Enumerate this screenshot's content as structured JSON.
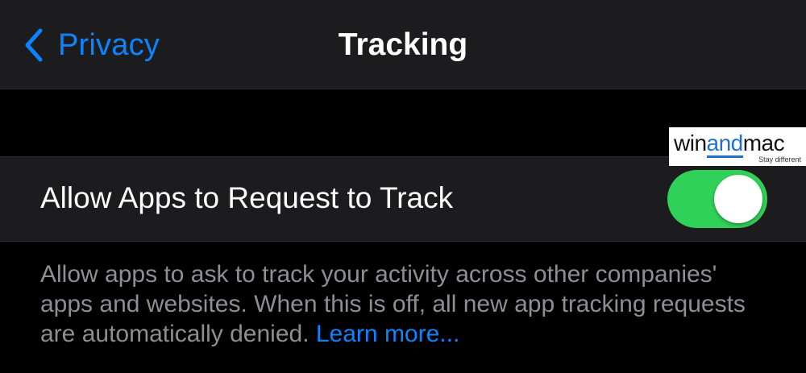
{
  "navbar": {
    "back_label": "Privacy",
    "title": "Tracking"
  },
  "setting": {
    "label": "Allow Apps to Request to Track",
    "toggle_on": true
  },
  "footer": {
    "description": "Allow apps to ask to track your activity across other companies' apps and websites. When this is off, all new app tracking requests are automatically denied. ",
    "learn_more": "Learn more..."
  },
  "watermark": {
    "logo_prefix": "win",
    "logo_highlight": "and",
    "logo_suffix": "mac",
    "tagline": "Stay different"
  },
  "colors": {
    "accent_blue": "#0a84ff",
    "toggle_green": "#30d158",
    "background": "#000000",
    "cell_background": "#1c1c1e",
    "secondary_text": "#8e8e93"
  },
  "icons": {
    "back": "chevron-left-icon"
  }
}
